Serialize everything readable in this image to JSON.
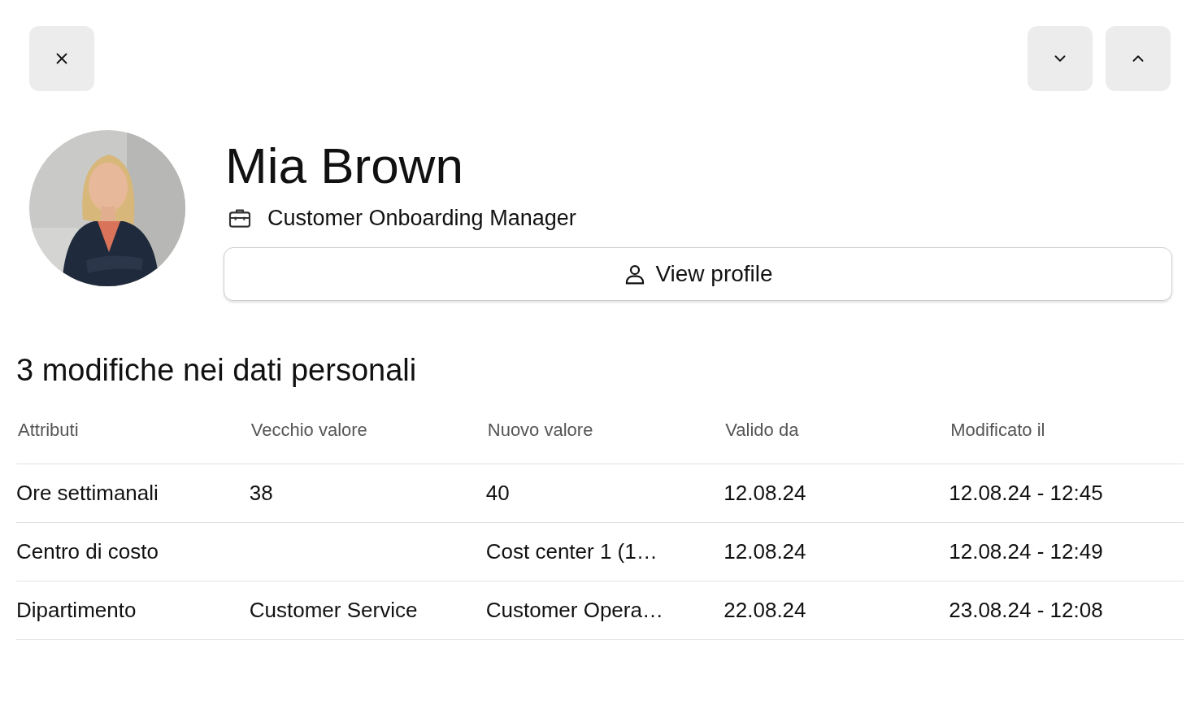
{
  "profile": {
    "name": "Mia Brown",
    "job_title": "Customer Onboarding Manager",
    "view_profile_button": "View profile"
  },
  "changes": {
    "title": "3 modifiche nei dati personali",
    "columns": [
      "Attributi",
      "Vecchio valore",
      "Nuovo valore",
      "Valido da",
      "Modificato il"
    ],
    "rows": [
      {
        "cells": [
          "Ore settimanali",
          "38",
          "40",
          "12.08.24",
          "12.08.24 - 12:45"
        ]
      },
      {
        "cells": [
          "Centro di costo",
          "",
          "Cost center 1 (1…",
          "12.08.24",
          "12.08.24 - 12:49"
        ]
      },
      {
        "cells": [
          "Dipartimento",
          "Customer Service",
          "Customer Opera…",
          "22.08.24",
          "23.08.24 - 12:08"
        ]
      }
    ]
  }
}
